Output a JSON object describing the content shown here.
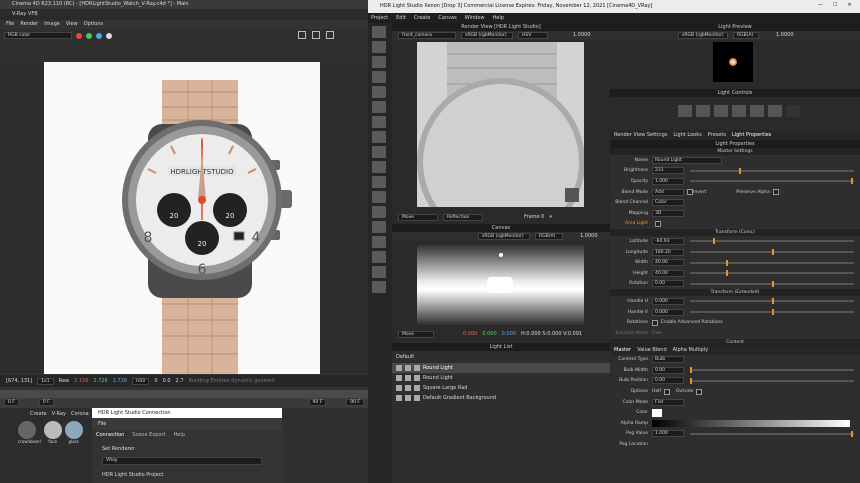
{
  "c4d": {
    "title": "Cinema 4D R23.110 (RC) - [HDRLightStudio_Watch_V-Ray.c4d *] - Main",
    "vfb_title": "V-Ray VFB",
    "menu": [
      "File",
      "Render",
      "Image",
      "View",
      "Options"
    ],
    "channel": "RGB color",
    "status": {
      "coords": "[674, 131]",
      "mode": "1x1",
      "raw": "Raw",
      "r": "2.726",
      "g": "2.726",
      "b": "2.726",
      "cs": "HSV",
      "h": "0",
      "s": "0.0",
      "v": "2.7",
      "message": "Building Embree dynamic geometry ins..."
    },
    "timeline": {
      "start": "0 F",
      "cur": "0 F",
      "end": "90 F",
      "end2": "90 F"
    },
    "materials": {
      "menu": [
        "Create",
        "V-Ray",
        "Corona"
      ],
      "items": [
        "crownbezel",
        "face",
        "glass"
      ]
    }
  },
  "hdr_connection": {
    "title": "HDR Light Studio Connection",
    "file": "File",
    "tabs": [
      "Connection",
      "Scene Export",
      "Help"
    ],
    "set_renderer": "Set Renderer",
    "renderer": "VRay",
    "project": "HDR Light Studio Project"
  },
  "hls": {
    "title": "HDR Light Studio Xenon [Drop 3] Commercial License Expires: Friday, November 12, 2021 [Cinema4D_VRay]",
    "menu": [
      "Project",
      "Edit",
      "Create",
      "Canvas",
      "Window",
      "Help"
    ],
    "render_view": {
      "head": "Render View [HDR Light Studio]",
      "camera": "front_camera",
      "cs": "sRGB (rgbMonitor)",
      "mode": "HSV",
      "value": "1.0000",
      "tool": "Move",
      "target": "Reflection",
      "frame": "Frame 0"
    },
    "canvas": {
      "head": "Canvas",
      "cs": "sRGB (rgbMonitor)",
      "mode": "RGB(A)",
      "value": "1.0000",
      "tool": "Move",
      "readout_r": "0.000",
      "readout_g": "0.000",
      "readout_b": "0.000",
      "hsv": "H:0.000 S:0.000 V:0.091"
    },
    "light_list": {
      "head": "Light List",
      "group": "Default",
      "items": [
        "Round Light",
        "Round Light",
        "Square Large Rad",
        "Default Gradient Background"
      ]
    },
    "preview": {
      "head": "Light Preview",
      "cs": "sRGB (rgbMonitor)",
      "mode": "RGB(A)",
      "value": "1.0000"
    },
    "controls_head": "Light Controls",
    "tabs": [
      "Render View Settings",
      "Light Looks",
      "Presets",
      "Light Properties"
    ],
    "props_head": "Light Properties",
    "sections": {
      "master": "Master Settings",
      "conic": "Transform (Conic)",
      "extended": "Transform (Extended)",
      "content": "Content"
    },
    "props": {
      "name_label": "Name",
      "name": "Round Light",
      "brightness_label": "Brightness",
      "brightness": "231",
      "opacity_label": "Opacity",
      "opacity": "1.000",
      "blend_label": "Blend Mode",
      "blend": "Add",
      "invert": "Invert",
      "preserve": "Preserve Alpha",
      "channel_label": "Blend Channel",
      "channel": "Color",
      "mapping_label": "Mapping",
      "mapping": "3D",
      "area_light": "Area Light",
      "lat_label": "Latitude",
      "lat": "-64.93",
      "lon_label": "Longitude",
      "lon": "180.20",
      "width_label": "Width",
      "width": "40.00",
      "height_label": "Height",
      "height": "40.00",
      "rot_label": "Rotation",
      "rot": "0.00",
      "hu_label": "Handle U",
      "hu": "0.000",
      "hv_label": "Handle V",
      "hv": "0.000",
      "rotations_label": "Rotations",
      "adv_rot": "Enable Advanced Rotations",
      "rot_mode_label": "Rotation Mode",
      "rot_mode": "Free",
      "content_tabs": [
        "Master",
        "Value Blend",
        "Alpha Multiply"
      ],
      "ctype_label": "Content Type",
      "ctype": "Bulb",
      "bwidth_label": "Bulb Width",
      "bwidth": "0.00",
      "bpos_label": "Bulb Position",
      "bpos": "0.00",
      "options_label": "Options",
      "half": "Half",
      "outside": "Outside",
      "cmode_label": "Color Mode",
      "cmode": "Flat",
      "color_label": "Color",
      "ramp_label": "Alpha Ramp",
      "peg_label": "Peg Value",
      "peg": "1.000",
      "peg_loc_label": "Peg Location"
    }
  },
  "watch": {
    "brand": "HDRLIGHTSTUDIO",
    "subdial_l": "20",
    "subdial_r": "20",
    "subdial_b": "20",
    "num_6": "6",
    "num_4": "4",
    "num_8": "8"
  },
  "colors": {
    "accent": "#e6922e",
    "bezel": "#9a9a9a",
    "strap": "#d8b49a"
  }
}
